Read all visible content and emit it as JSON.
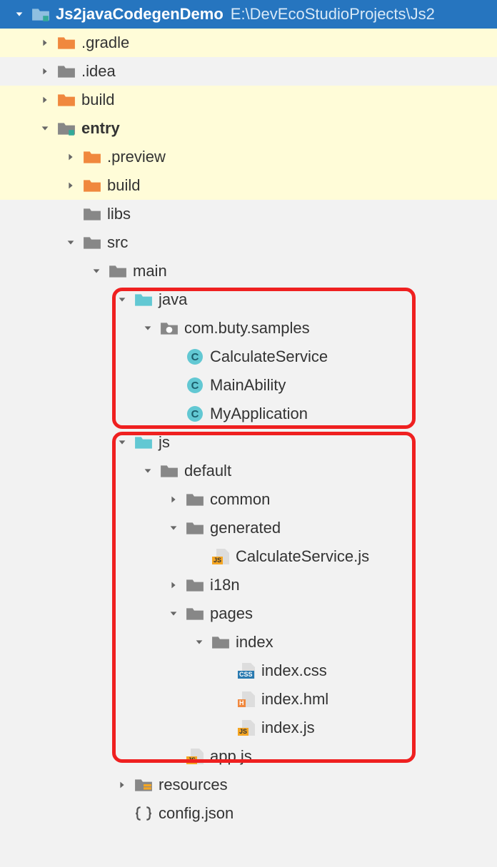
{
  "root": {
    "name": "Js2javaCodegenDemo",
    "path": "E:\\DevEcoStudioProjects\\Js2"
  },
  "nodes": {
    "gradle": ".gradle",
    "idea": ".idea",
    "build": "build",
    "entry": "entry",
    "preview": ".preview",
    "build2": "build",
    "libs": "libs",
    "src": "src",
    "main": "main",
    "java": "java",
    "pkg": "com.buty.samples",
    "cls1": "CalculateService",
    "cls2": "MainAbility",
    "cls3": "MyApplication",
    "js": "js",
    "default": "default",
    "common": "common",
    "generated": "generated",
    "genfile": "CalculateService.js",
    "i18n": "i18n",
    "pages": "pages",
    "index": "index",
    "indexcss": "index.css",
    "indexhml": "index.hml",
    "indexjs": "index.js",
    "appjs": "app.js",
    "resources": "resources",
    "config": "config.json"
  }
}
